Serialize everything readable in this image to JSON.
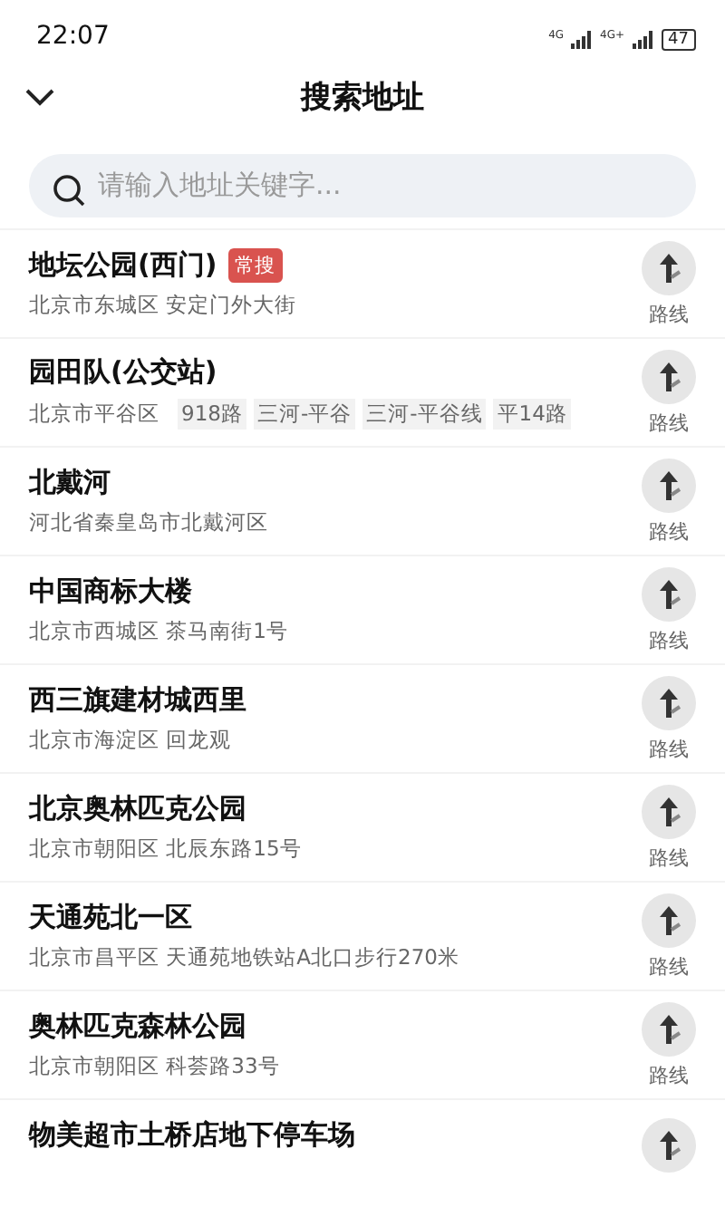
{
  "status_bar": {
    "time": "22:07",
    "network_1": "4G",
    "network_2": "4G+",
    "battery": "47"
  },
  "header": {
    "title": "搜索地址"
  },
  "search": {
    "placeholder": "请输入地址关键字..."
  },
  "results": [
    {
      "name": "地坛公园(西门)",
      "badge": "常搜",
      "address": "北京市东城区 安定门外大街",
      "route": "路线"
    },
    {
      "name": "园田队(公交站)",
      "address": "北京市平谷区",
      "lines": [
        "918路",
        "三河-平谷",
        "三河-平谷线",
        "平14路"
      ],
      "route": "路线"
    },
    {
      "name": "北戴河",
      "address": "河北省秦皇岛市北戴河区",
      "route": "路线"
    },
    {
      "name": "中国商标大楼",
      "address": "北京市西城区 茶马南街1号",
      "route": "路线"
    },
    {
      "name": "西三旗建材城西里",
      "address": "北京市海淀区 回龙观",
      "route": "路线"
    },
    {
      "name": "北京奥林匹克公园",
      "address": "北京市朝阳区 北辰东路15号",
      "route": "路线"
    },
    {
      "name": "天通苑北一区",
      "address": "北京市昌平区 天通苑地铁站A北口步行270米",
      "route": "路线"
    },
    {
      "name": "奥林匹克森林公园",
      "address": "北京市朝阳区 科荟路33号",
      "route": "路线"
    },
    {
      "name": "物美超市土桥店地下停车场"
    }
  ]
}
